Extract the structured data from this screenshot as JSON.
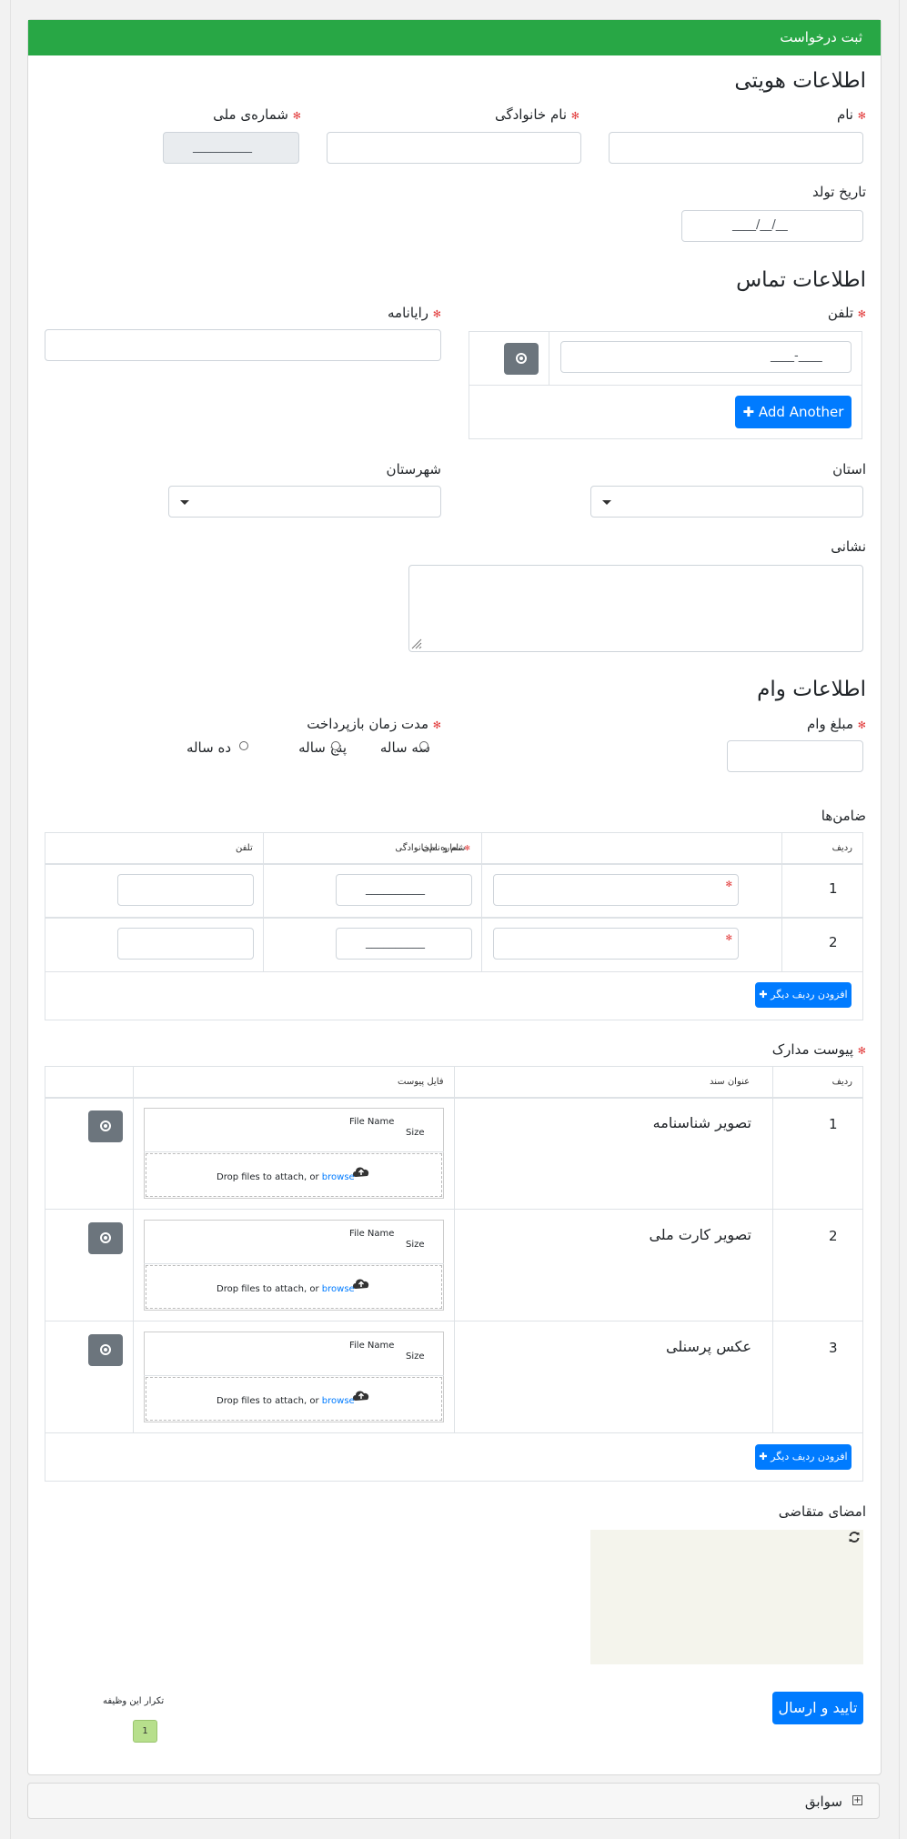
{
  "header": {
    "title": "ثبت درخواست"
  },
  "identity": {
    "section_title": "اطلاعات هویتی",
    "first_name_label": "نام",
    "last_name_label": "نام خانوادگی",
    "national_id_label": "شماره‌ی ملی",
    "national_id_mask": "__________",
    "birth_date_label": "تاریخ تولد",
    "birth_date_mask": "____/__/__"
  },
  "contact": {
    "section_title": "اطلاعات تماس",
    "phone_label": "تلفن",
    "phone_mask": "____-____",
    "email_label": "رایانامه",
    "add_another_label": "Add Another",
    "province_label": "استان",
    "city_label": "شهرستان",
    "address_label": "نشانی"
  },
  "loan": {
    "section_title": "اطلاعات وام",
    "amount_label": "مبلغ وام",
    "term_label": "مدت زمان بازپرداخت",
    "term_options": [
      "سه ساله",
      "پنج ساله",
      "ده ساله"
    ]
  },
  "guarantors": {
    "title": "ضامن‌ها",
    "columns": [
      "ردیف",
      "نام و نام‌خانوادگی",
      "شماره ملی",
      "تلفن"
    ],
    "rows": [
      {
        "index": "1",
        "national_id_mask": "__________"
      },
      {
        "index": "2",
        "national_id_mask": "__________"
      }
    ],
    "add_row_label": "افزودن ردیف دیگر"
  },
  "attachments": {
    "title": "پیوست مدارک",
    "columns": [
      "ردیف",
      "عنوان سند",
      "فایل پیوست"
    ],
    "rows": [
      {
        "index": "1",
        "doc_title": "تصویر شناسنامه"
      },
      {
        "index": "2",
        "doc_title": "تصویر کارت ملی"
      },
      {
        "index": "3",
        "doc_title": "عکس پرسنلی"
      }
    ],
    "file_name_label": "File Name",
    "size_label": "Size",
    "drop_text": "Drop files to attach, or",
    "browse_label": "browse",
    "add_row_label": "افزودن ردیف دیگر"
  },
  "signature": {
    "label": "امضای متقاضی"
  },
  "footer": {
    "submit_label": "تایید و ارسال",
    "repeat_label": "تکرار این وظیفه",
    "repeat_count": "1",
    "history_label": "سوابق"
  },
  "colors": {
    "header_green": "#28a745",
    "primary_blue": "#007bff",
    "required_red": "#e23b3b",
    "signature_bg": "#f4f4ec",
    "repeat_badge": "#b7df8c"
  }
}
